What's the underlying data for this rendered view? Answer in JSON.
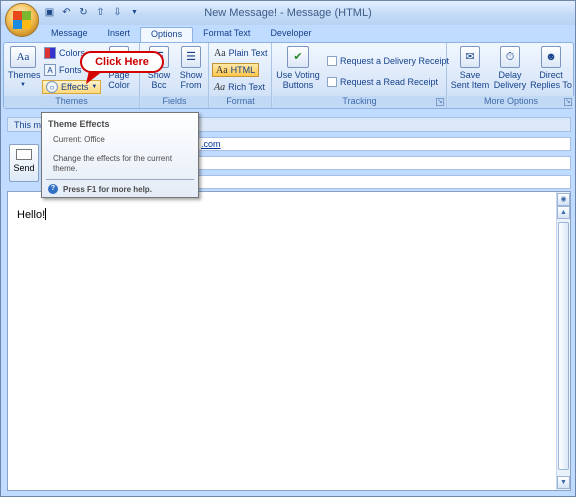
{
  "window": {
    "title": "New Message! - Message (HTML)"
  },
  "quick_access": {
    "icons": [
      "save-icon",
      "undo-icon",
      "redo-icon",
      "up-arrow-icon",
      "down-arrow-icon",
      "customize-icon"
    ]
  },
  "tabs": [
    {
      "label": "Message"
    },
    {
      "label": "Insert"
    },
    {
      "label": "Options",
      "active": true
    },
    {
      "label": "Format Text"
    },
    {
      "label": "Developer"
    }
  ],
  "ribbon": {
    "themes_group": {
      "label": "Themes",
      "themes_button": "Themes",
      "colors": "Colors",
      "fonts": "Fonts",
      "effects": "Effects",
      "page_color": "Page Color"
    },
    "fields_group": {
      "label": "Fields",
      "show_bcc": "Show Bcc",
      "show_from": "Show From"
    },
    "format_group": {
      "label": "Format",
      "plain_text": "Plain Text",
      "html": "HTML",
      "rich_text": "Rich Text"
    },
    "tracking_group": {
      "label": "Tracking",
      "use_voting": "Use Voting Buttons",
      "delivery_receipt": "Request a Delivery Receipt",
      "read_receipt": "Request a Read Receipt"
    },
    "more_options_group": {
      "label": "More Options",
      "save_sent": "Save Sent Item",
      "delay_delivery": "Delay Delivery",
      "direct_replies": "Direct Replies To"
    }
  },
  "infobar": {
    "text": "This me"
  },
  "compose": {
    "send_label": "Send",
    "to_value": ".com",
    "body_text": "Hello!"
  },
  "tooltip": {
    "title": "Theme Effects",
    "current": "Current: Office",
    "description": "Change the effects for the current theme.",
    "help": "Press F1 for more help."
  },
  "callout": {
    "text": "Click Here"
  },
  "colors": {
    "callout_red": "#d40000",
    "ribbon_blue": "#15428b",
    "highlight_orange": "#ffc64a"
  }
}
